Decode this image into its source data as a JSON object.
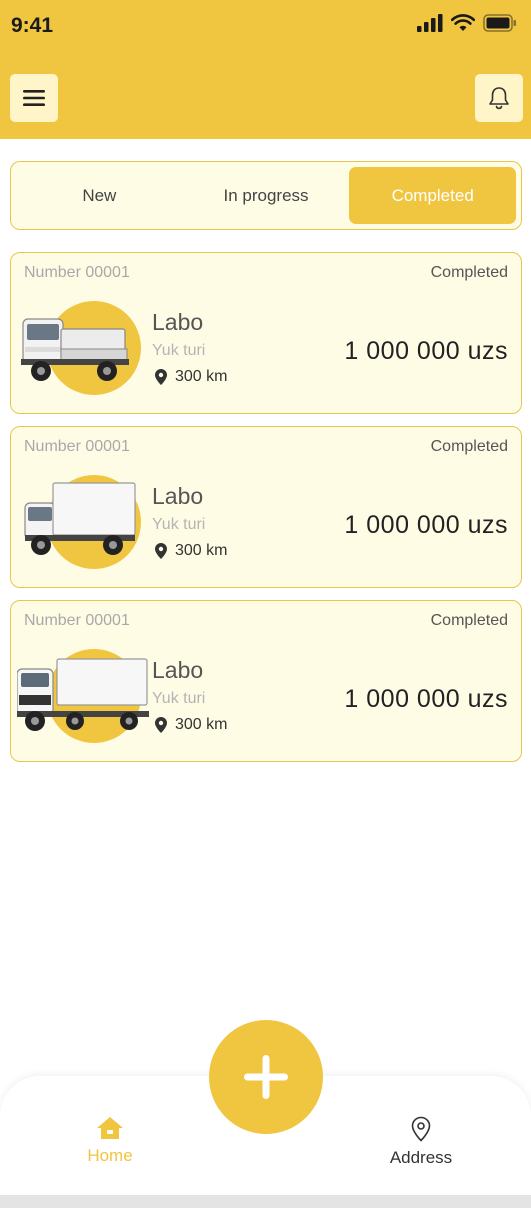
{
  "status_bar": {
    "time": "9:41"
  },
  "header": {
    "menu_icon": "hamburger-menu-icon",
    "bell_icon": "bell-icon"
  },
  "tabs": [
    {
      "label": "New",
      "active": false
    },
    {
      "label": "In progress",
      "active": false
    },
    {
      "label": "Completed",
      "active": true
    }
  ],
  "orders": [
    {
      "number": "Number 00001",
      "status": "Completed",
      "name": "Labo",
      "type": "Yuk turi",
      "distance": "300 km",
      "price": "1 000 000 uzs",
      "vehicle": "mini-truck"
    },
    {
      "number": "Number 00001",
      "status": "Completed",
      "name": "Labo",
      "type": "Yuk turi",
      "distance": "300 km",
      "price": "1 000 000 uzs",
      "vehicle": "box-truck"
    },
    {
      "number": "Number 00001",
      "status": "Completed",
      "name": "Labo",
      "type": "Yuk turi",
      "distance": "300 km",
      "price": "1 000 000 uzs",
      "vehicle": "semi-truck"
    }
  ],
  "bottom_nav": {
    "home_label": "Home",
    "address_label": "Address",
    "add_icon": "plus-icon"
  },
  "colors": {
    "accent": "#F0C540",
    "card_bg": "#FFFCE6",
    "card_border": "#E8C64A"
  }
}
